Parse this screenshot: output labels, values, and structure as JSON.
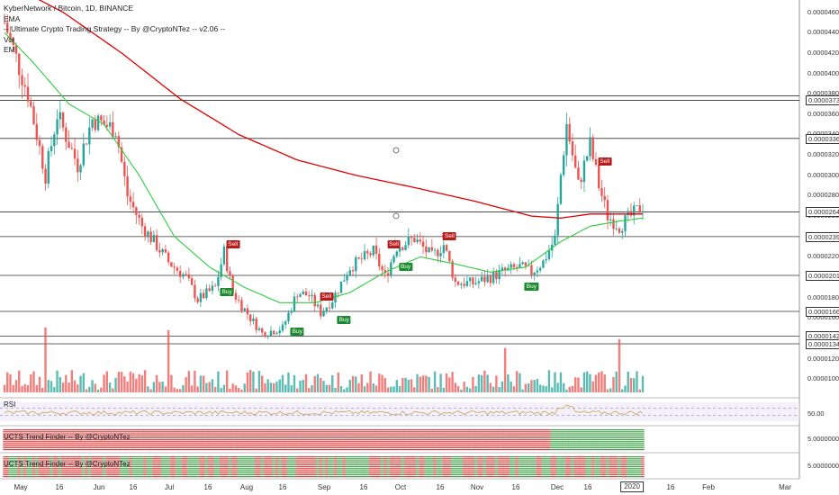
{
  "legend": {
    "title": "KyberNetwork / Bitcoin, 1D, BINANCE",
    "strategy": "-- Ultimate Crypto Trading Strategy -- By @CryptoNTez -- v2.06 --",
    "vol": "Vol",
    "ema": "EMA",
    "em": "EM"
  },
  "panes": {
    "rsi_label": "RSI",
    "rsi_value": "50.00",
    "ucts1_label": "UCTS Trend Finder -- By @CryptoNTez",
    "ucts1_value": "5.00000000",
    "ucts2_label": "UCTS Trend Finder -- By @CryptoNTez",
    "ucts2_value": "5.00000000"
  },
  "colors": {
    "up": "#26a69a",
    "down": "#ef5350",
    "ema_fast": "#2ecc40",
    "ema_slow": "#e00000",
    "rsi": "#c8a050",
    "buy": "#1b8a2e",
    "sell": "#b71c1c",
    "ucts_bull": "#1f8f2a",
    "ucts_bear": "#d32020"
  },
  "chart_data": {
    "type": "candlestick",
    "symbol": "KyberNetwork / Bitcoin",
    "timeframe": "1D",
    "exchange": "BINANCE",
    "y_axis_ticks": [
      "0.00004600",
      "0.00004400",
      "0.00004200",
      "0.00004000",
      "0.00003800",
      "0.00003600",
      "0.00003400",
      "0.00003200",
      "0.00003000",
      "0.00002800",
      "0.00002600",
      "0.00002400",
      "0.00002200",
      "0.00002000",
      "0.00001800",
      "0.00001600",
      "0.00001400",
      "0.00001200",
      "0.00001000"
    ],
    "ylim": [
      8.7e-06,
      4.72e-05
    ],
    "x_axis_ticks": [
      "May",
      "16",
      "Jun",
      "16",
      "Jul",
      "16",
      "Aug",
      "16",
      "Sep",
      "16",
      "Oct",
      "16",
      "Nov",
      "16",
      "Dec",
      "16",
      "2020",
      "16",
      "Feb",
      "Mar"
    ],
    "x_highlight": "2020",
    "horizontal_levels": [
      {
        "value": 3.78e-05,
        "label": "0.00003780"
      },
      {
        "value": 3.736e-05,
        "label": "0.00003736"
      },
      {
        "value": 3.362e-05,
        "label": "0.00003362"
      },
      {
        "value": 2.641e-05,
        "label": "0.00002641"
      },
      {
        "value": 2.399e-05,
        "label": "0.00002399"
      },
      {
        "value": 2.018e-05,
        "label": "0.00002018"
      },
      {
        "value": 1.665e-05,
        "label": "0.00001665"
      },
      {
        "value": 1.422e-05,
        "label": "0.00001422"
      },
      {
        "value": 1.347e-05,
        "label": "0.00001347"
      }
    ],
    "boxed_labels": [
      "0.00003736",
      "0.00003362",
      "0.00002641",
      "0.00002399",
      "0.00002018",
      "0.00001665",
      "0.00001422",
      "0.00001347"
    ],
    "close_series": {
      "start": "2019-04-25",
      "interval": "1D",
      "anchors": [
        [
          0,
          4.5e-05
        ],
        [
          8,
          3.8e-05
        ],
        [
          14,
          3e-05
        ],
        [
          18,
          3.6e-05
        ],
        [
          25,
          3.1e-05
        ],
        [
          30,
          3.55e-05
        ],
        [
          38,
          3.45e-05
        ],
        [
          42,
          2.8e-05
        ],
        [
          47,
          2.5e-05
        ],
        [
          51,
          2.35e-05
        ],
        [
          56,
          2.15e-05
        ],
        [
          62,
          2e-05
        ],
        [
          66,
          1.78e-05
        ],
        [
          72,
          1.9e-05
        ],
        [
          75,
          2.25e-05
        ],
        [
          78,
          1.85e-05
        ],
        [
          84,
          1.6e-05
        ],
        [
          88,
          1.45e-05
        ],
        [
          95,
          1.5e-05
        ],
        [
          100,
          1.85e-05
        ],
        [
          104,
          1.82e-05
        ],
        [
          108,
          1.65e-05
        ],
        [
          112,
          1.78e-05
        ],
        [
          118,
          2.1e-05
        ],
        [
          126,
          2.25e-05
        ],
        [
          130,
          2e-05
        ],
        [
          134,
          2.3e-05
        ],
        [
          140,
          2.38e-05
        ],
        [
          146,
          2.2e-05
        ],
        [
          150,
          2.32e-05
        ],
        [
          154,
          1.95e-05
        ],
        [
          160,
          1.94e-05
        ],
        [
          166,
          2e-05
        ],
        [
          170,
          2.05e-05
        ],
        [
          176,
          2.1e-05
        ],
        [
          180,
          2.05e-05
        ],
        [
          184,
          2.15e-05
        ],
        [
          188,
          2.38e-05
        ],
        [
          190,
          3e-05
        ],
        [
          192,
          3.5e-05
        ],
        [
          194,
          3.2e-05
        ],
        [
          196,
          2.9e-05
        ],
        [
          200,
          3.3e-05
        ],
        [
          203,
          2.9e-05
        ],
        [
          206,
          2.6e-05
        ],
        [
          210,
          2.5e-05
        ],
        [
          214,
          2.6e-05
        ],
        [
          218,
          2.7e-05
        ]
      ]
    },
    "ema_fast_anchors": [
      [
        0,
        4.4e-05
      ],
      [
        10,
        4.1e-05
      ],
      [
        22,
        3.7e-05
      ],
      [
        34,
        3.5e-05
      ],
      [
        46,
        3e-05
      ],
      [
        58,
        2.4e-05
      ],
      [
        70,
        2.1e-05
      ],
      [
        82,
        1.9e-05
      ],
      [
        94,
        1.75e-05
      ],
      [
        106,
        1.75e-05
      ],
      [
        118,
        1.85e-05
      ],
      [
        130,
        2.05e-05
      ],
      [
        142,
        2.2e-05
      ],
      [
        154,
        2.13e-05
      ],
      [
        166,
        2.05e-05
      ],
      [
        178,
        2.1e-05
      ],
      [
        190,
        2.35e-05
      ],
      [
        200,
        2.5e-05
      ],
      [
        210,
        2.55e-05
      ],
      [
        218,
        2.58e-05
      ]
    ],
    "ema_slow_anchors": [
      [
        0,
        4.9e-05
      ],
      [
        20,
        4.6e-05
      ],
      [
        40,
        4.2e-05
      ],
      [
        60,
        3.75e-05
      ],
      [
        80,
        3.4e-05
      ],
      [
        100,
        3.15e-05
      ],
      [
        120,
        3e-05
      ],
      [
        140,
        2.88e-05
      ],
      [
        160,
        2.75e-05
      ],
      [
        180,
        2.6e-05
      ],
      [
        190,
        2.58e-05
      ],
      [
        200,
        2.62e-05
      ],
      [
        210,
        2.62e-05
      ],
      [
        218,
        2.62e-05
      ]
    ],
    "signals": [
      {
        "type": "Sell",
        "label": "Sell",
        "i": 78,
        "price": 2.32e-05
      },
      {
        "type": "Buy",
        "label": "Buy",
        "i": 76,
        "price": 1.85e-05
      },
      {
        "type": "Buy",
        "label": "Buy",
        "i": 100,
        "price": 1.46e-05
      },
      {
        "type": "Sell",
        "label": "Sell",
        "i": 110,
        "price": 1.81e-05
      },
      {
        "type": "Buy",
        "label": "Buy",
        "i": 116,
        "price": 1.58e-05
      },
      {
        "type": "Sell",
        "label": "Sell",
        "i": 133,
        "price": 2.32e-05
      },
      {
        "type": "Buy",
        "label": "Buy",
        "i": 137,
        "price": 2.1e-05
      },
      {
        "type": "Sell",
        "label": "Sell",
        "i": 152,
        "price": 2.4e-05
      },
      {
        "type": "Buy",
        "label": "Buy",
        "i": 180,
        "price": 1.9e-05
      },
      {
        "type": "Sell",
        "label": "Sell",
        "i": 205,
        "price": 3.13e-05
      }
    ],
    "rsi_level": 50
  }
}
